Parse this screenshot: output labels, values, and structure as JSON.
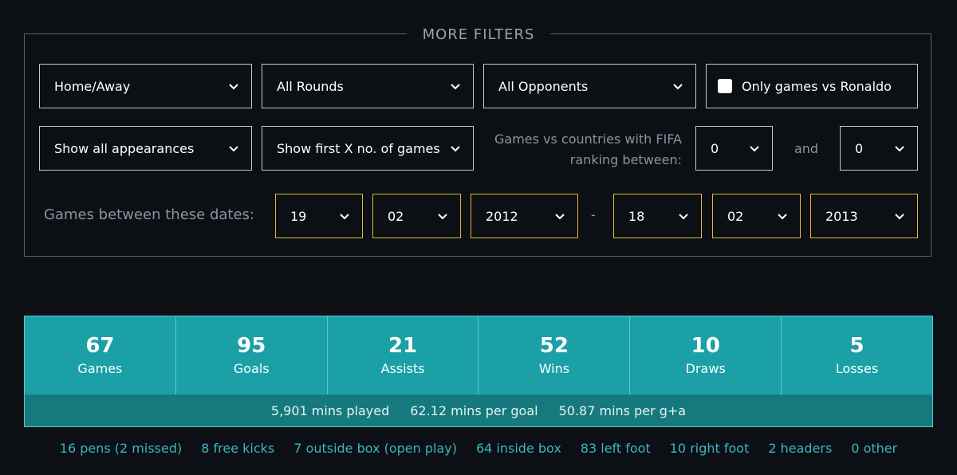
{
  "filters": {
    "title": "MORE FILTERS",
    "home_away": "Home/Away",
    "rounds": "All Rounds",
    "opponents": "All Opponents",
    "vs_ronaldo": "Only games vs Ronaldo",
    "appearances": "Show all appearances",
    "first_x": "Show first X no. of games",
    "fifa_label_line1": "Games vs countries with FIFA",
    "fifa_label_line2": "ranking between:",
    "fifa_from": "0",
    "and_label": "and",
    "fifa_to": "0",
    "dates_label": "Games between these dates:",
    "start_day": "19",
    "start_month": "02",
    "start_year": "2012",
    "dash": "-",
    "end_day": "18",
    "end_month": "02",
    "end_year": "2013"
  },
  "stats": [
    {
      "value": "67",
      "label": "Games"
    },
    {
      "value": "95",
      "label": "Goals"
    },
    {
      "value": "21",
      "label": "Assists"
    },
    {
      "value": "52",
      "label": "Wins"
    },
    {
      "value": "10",
      "label": "Draws"
    },
    {
      "value": "5",
      "label": "Losses"
    }
  ],
  "sub_stats": {
    "mins_played": "5,901 mins played",
    "mins_per_goal": "62.12 mins per goal",
    "mins_per_ga": "50.87 mins per g+a"
  },
  "goal_types": [
    "16 pens (2 missed)",
    "8 free kicks",
    "7 outside box (open play)",
    "64 inside box",
    "83 left foot",
    "10 right foot",
    "2 headers",
    "0 other"
  ],
  "colors": {
    "background": "#0c0f14",
    "teal": "#1aa0a6",
    "teal_dark": "#15797d",
    "gold": "#e3b63c",
    "link_teal": "#3bb7c0"
  }
}
